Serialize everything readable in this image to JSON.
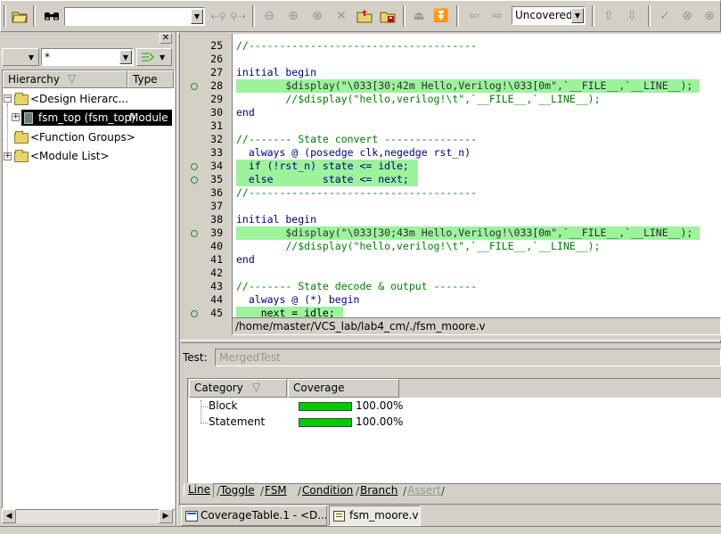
{
  "toolbar": {
    "search_value": "",
    "filter_value": "Uncovered"
  },
  "left_panel": {
    "filter_value": "*",
    "col_hierarchy": "Hierarchy",
    "col_type": "Type",
    "tree": [
      {
        "label": "<Design Hierarc..."
      },
      {
        "label": "fsm_top (fsm_top)",
        "type": "Module"
      },
      {
        "label": "<Function Groups>"
      },
      {
        "label": "<Module List>"
      }
    ]
  },
  "code": {
    "lines": [
      {
        "n": "25",
        "text": "//-------------------------------------",
        "cov": false,
        "mark": false
      },
      {
        "n": "26",
        "text": "",
        "cov": false,
        "mark": false
      },
      {
        "n": "27",
        "text": "initial begin",
        "cov": false,
        "mark": false
      },
      {
        "n": "28",
        "text": "        $display(\"\\033[30;42m Hello,Verilog!\\033[0m\",`__FILE__,`__LINE__);",
        "cov": true,
        "mark": true
      },
      {
        "n": "29",
        "text": "        //$display(\"hello,verilog!\\t\",`__FILE__,`__LINE__);",
        "cov": false,
        "mark": false
      },
      {
        "n": "30",
        "text": "end",
        "cov": false,
        "mark": false
      },
      {
        "n": "31",
        "text": "",
        "cov": false,
        "mark": false
      },
      {
        "n": "32",
        "text": "//------- State convert ---------------",
        "cov": false,
        "mark": false
      },
      {
        "n": "33",
        "text": "  always @ (posedge clk,negedge rst_n)",
        "cov": false,
        "mark": false
      },
      {
        "n": "34",
        "text": "  if (!rst_n) state <= idle;",
        "cov": true,
        "mark": true
      },
      {
        "n": "35",
        "text": "  else        state <= next;",
        "cov": true,
        "mark": true
      },
      {
        "n": "36",
        "text": "//-------------------------------------",
        "cov": false,
        "mark": false
      },
      {
        "n": "37",
        "text": "",
        "cov": false,
        "mark": false
      },
      {
        "n": "38",
        "text": "initial begin",
        "cov": false,
        "mark": false
      },
      {
        "n": "39",
        "text": "        $display(\"\\033[30;43m Hello,Verilog!\\033[0m\",`__FILE__,`__LINE__);",
        "cov": true,
        "mark": true
      },
      {
        "n": "40",
        "text": "        //$display(\"hello,verilog!\\t\",`__FILE__,`__LINE__);",
        "cov": false,
        "mark": false
      },
      {
        "n": "41",
        "text": "end",
        "cov": false,
        "mark": false
      },
      {
        "n": "42",
        "text": "",
        "cov": false,
        "mark": false
      },
      {
        "n": "43",
        "text": "//------- State decode & output -------",
        "cov": false,
        "mark": false
      },
      {
        "n": "44",
        "text": "  always @ (*) begin",
        "cov": false,
        "mark": false
      },
      {
        "n": "45",
        "text": "    next = idle;",
        "cov": true,
        "mark": true
      }
    ],
    "file_path": "/home/master/VCS_lab/lab4_cm/./fsm_moore.v"
  },
  "bottom": {
    "test_label": "Test:",
    "test_value": "MergedTest",
    "col_category": "Category",
    "col_coverage": "Coverage",
    "rows": [
      {
        "category": "Block",
        "coverage": "100.00%",
        "fraction": 1.0
      },
      {
        "category": "Statement",
        "coverage": "100.00%",
        "fraction": 1.0
      }
    ],
    "tabs": [
      "Line",
      "Toggle",
      "FSM",
      "Condition",
      "Branch",
      "Assert"
    ]
  },
  "taskbar": {
    "items": [
      "CoverageTable.1 - <D...",
      "fsm_moore.v"
    ]
  },
  "colors": {
    "covered_bg": "#9cf39c",
    "coverage_bar": "#00cc00"
  }
}
